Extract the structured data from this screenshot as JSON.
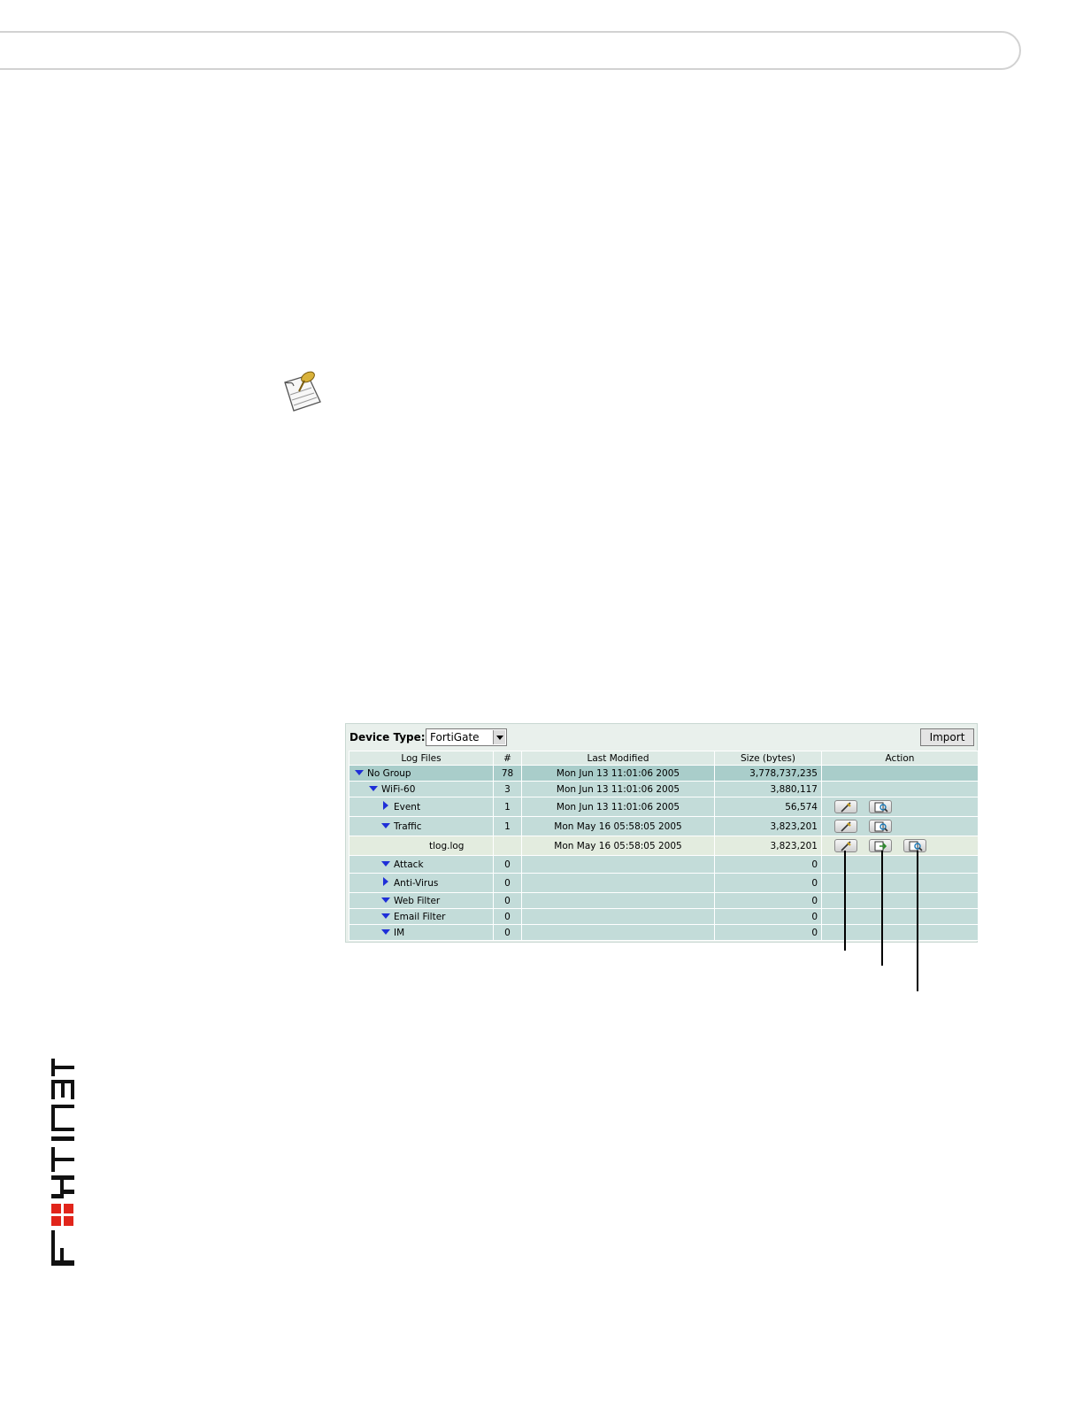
{
  "panel": {
    "device_type_label": "Device Type:",
    "device_type_value": "FortiGate",
    "import_label": "Import"
  },
  "table": {
    "headers": [
      "Log Files",
      "#",
      "Last Modified",
      "Size (bytes)",
      "Action"
    ],
    "rows": [
      {
        "name": "No Group",
        "count": "78",
        "modified": "Mon Jun 13 11:01:06 2005",
        "size": "3,778,737,235"
      },
      {
        "name": "WiFi-60",
        "count": "3",
        "modified": "Mon Jun 13 11:01:06 2005",
        "size": "3,880,117"
      },
      {
        "name": "Event",
        "count": "1",
        "modified": "Mon Jun 13 11:01:06 2005",
        "size": "56,574"
      },
      {
        "name": "Traffic",
        "count": "1",
        "modified": "Mon May 16 05:58:05 2005",
        "size": "3,823,201"
      },
      {
        "name": "tlog.log",
        "count": "",
        "modified": "Mon May 16 05:58:05 2005",
        "size": "3,823,201"
      },
      {
        "name": "Attack",
        "count": "0",
        "modified": "",
        "size": "0"
      },
      {
        "name": "Anti-Virus",
        "count": "0",
        "modified": "",
        "size": "0"
      },
      {
        "name": "Web Filter",
        "count": "0",
        "modified": "",
        "size": "0"
      },
      {
        "name": "Email Filter",
        "count": "0",
        "modified": "",
        "size": "0"
      },
      {
        "name": "IM",
        "count": "0",
        "modified": "",
        "size": "0"
      }
    ]
  },
  "icons": [
    "note-pin-icon",
    "expand-down-icon",
    "collapse-right-icon",
    "edit-icon",
    "convert-icon",
    "view-icon",
    "fortinet-logo"
  ],
  "colors": {
    "group_row": "#a9cdca",
    "level_row": "#c3dcd9",
    "file_row": "#e3ecdf",
    "tree_arrow": "#1f2fd8",
    "logo_red": "#e1251b"
  }
}
